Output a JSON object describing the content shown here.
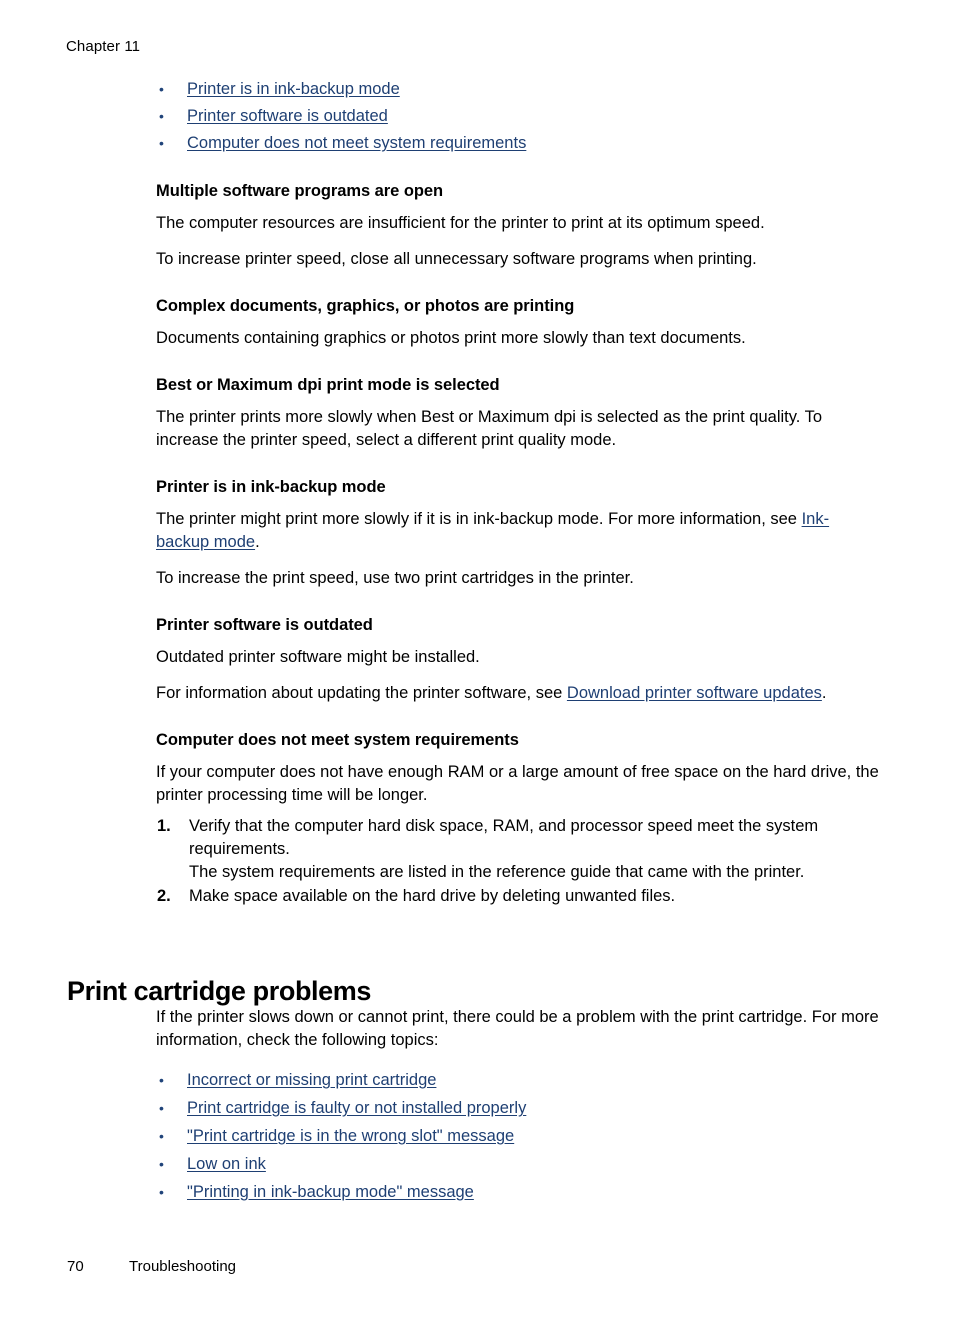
{
  "header": {
    "chapter_label": "Chapter 11"
  },
  "colors": {
    "link": "#1e3f73",
    "bullet": "#20447a",
    "text": "#000000",
    "background": "#ffffff"
  },
  "top_links": {
    "bullet_glyph": "•",
    "items": [
      {
        "label": "Printer is in ink-backup mode"
      },
      {
        "label": "Printer software is outdated"
      },
      {
        "label": "Computer does not meet system requirements"
      }
    ]
  },
  "sections": [
    {
      "heading": "Multiple software programs are open",
      "paragraphs": [
        "The computer resources are insufficient for the printer to print at its optimum speed.",
        "To increase printer speed, close all unnecessary software programs when printing."
      ]
    },
    {
      "heading": "Complex documents, graphics, or photos are printing",
      "paragraphs": [
        "Documents containing graphics or photos print more slowly than text documents."
      ]
    },
    {
      "heading": "Best or Maximum dpi print mode is selected",
      "paragraphs": [
        "The printer prints more slowly when Best or Maximum dpi is selected as the print quality. To increase the printer speed, select a different print quality mode."
      ]
    },
    {
      "heading": "Printer is in ink-backup mode",
      "para_with_link_prefix": "The printer might print more slowly if it is in ink-backup mode. For more information, see ",
      "para_link": "Ink-backup mode",
      "para_with_link_suffix": ".",
      "paragraph_after": "To increase the print speed, use two print cartridges in the printer."
    },
    {
      "heading": "Printer software is outdated",
      "paragraph_first": "Outdated printer software might be installed.",
      "para_with_link_prefix": "For information about updating the printer software, see ",
      "para_link": "Download printer software updates",
      "para_with_link_suffix": "."
    },
    {
      "heading": "Computer does not meet system requirements",
      "intro": "If your computer does not have enough RAM or a large amount of free space on the hard drive, the printer processing time will be longer.",
      "steps": [
        {
          "number": "1.",
          "text": "Verify that the computer hard disk space, RAM, and processor speed meet the system requirements.",
          "sub_text": "The system requirements are listed in the reference guide that came with the printer."
        },
        {
          "number": "2.",
          "text": "Make space available on the hard drive by deleting unwanted files.",
          "sub_text": ""
        }
      ]
    }
  ],
  "print_cartridge": {
    "title": "Print cartridge problems",
    "intro": "If the printer slows down or cannot print, there could be a problem with the print cartridge. For more information, check the following topics:",
    "bullet_glyph": "•",
    "links": [
      {
        "label": "Incorrect or missing print cartridge"
      },
      {
        "label": "Print cartridge is faulty or not installed properly"
      },
      {
        "label": "\"Print cartridge is in the wrong slot\" message"
      },
      {
        "label": "Low on ink"
      },
      {
        "label": "\"Printing in ink-backup mode\" message"
      }
    ]
  },
  "footer": {
    "page_number": "70",
    "section_name": "Troubleshooting"
  }
}
